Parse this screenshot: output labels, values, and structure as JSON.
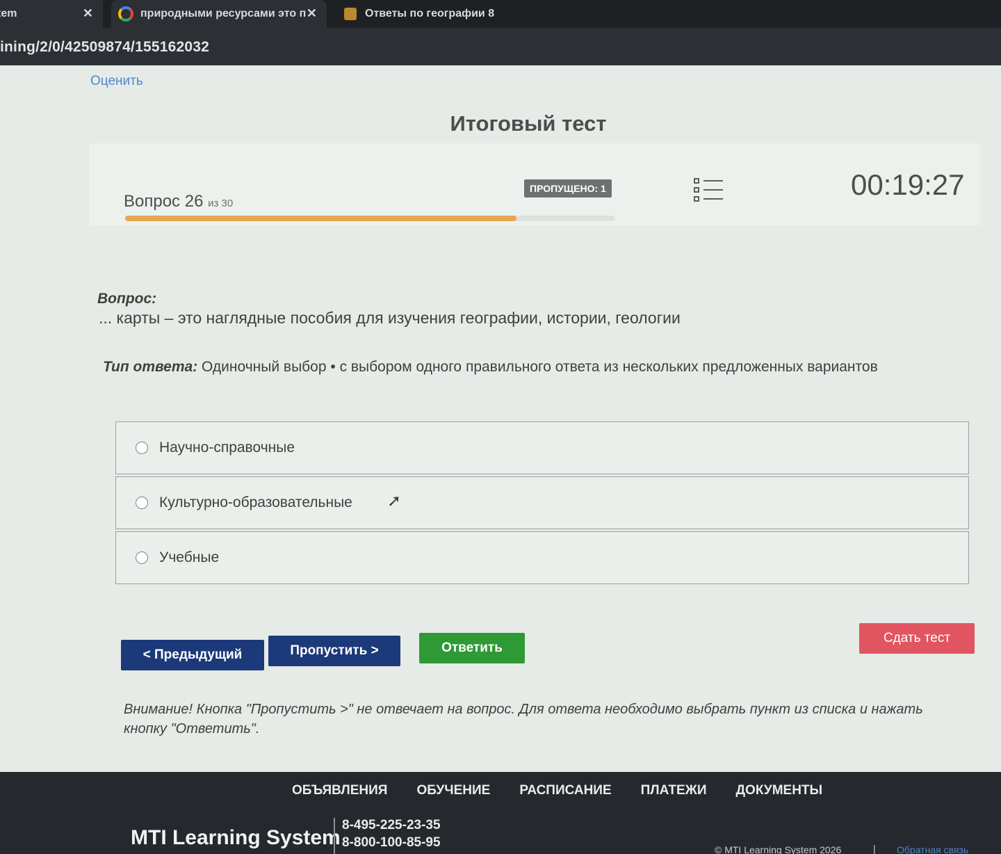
{
  "browser": {
    "tabs": [
      {
        "label": "tem",
        "close": "✕"
      },
      {
        "label": "природными ресурсами это п",
        "close": "✕"
      },
      {
        "label": "Ответы по географии 8"
      }
    ],
    "url": "ining/2/0/42509874/155162032"
  },
  "page": {
    "rate_link": "Оценить",
    "title": "Итоговый тест"
  },
  "progress": {
    "question_label": "Вопрос 26",
    "question_of": "из 30",
    "current": 26,
    "total": 30,
    "fill_fraction": 0.8,
    "skipped_badge": "ПРОПУЩЕНО: 1",
    "timer": "00:19:27"
  },
  "question": {
    "heading": "Вопрос:",
    "text": "... карты – это наглядные пособия для изучения географии, истории, геологии",
    "answer_type_label": "Тип ответа:",
    "answer_type_value": " Одиночный выбор • с выбором одного правильного ответа из нескольких предложенных вариантов",
    "options": [
      "Научно-справочные",
      "Культурно-образовательные",
      "Учебные"
    ]
  },
  "buttons": {
    "prev": "< Предыдущий",
    "skip": "Пропустить >",
    "answer": "Ответить",
    "submit": "Сдать тест"
  },
  "note": "Внимание! Кнопка \"Пропустить >\" не отвечает на вопрос. Для ответа необходимо выбрать пункт из списка и нажать кнопку \"Ответить\".",
  "footer": {
    "nav": [
      "ОБЪЯВЛЕНИЯ",
      "ОБУЧЕНИЕ",
      "РАСПИСАНИЕ",
      "ПЛАТЕЖИ",
      "ДОКУМЕНТЫ"
    ],
    "brand": "MTI Learning System",
    "phone1": "8-495-225-23-35",
    "phone2": "8-800-100-85-95",
    "copyright": "© MTI Learning System 2026",
    "separator": "|",
    "feedback": "Обратная связь"
  },
  "colors": {
    "progress_fill": "#e6a74c",
    "primary_button": "#1c3a7a",
    "answer_button": "#2f9a35",
    "submit_button": "#e05560",
    "link": "#4f86c9"
  }
}
